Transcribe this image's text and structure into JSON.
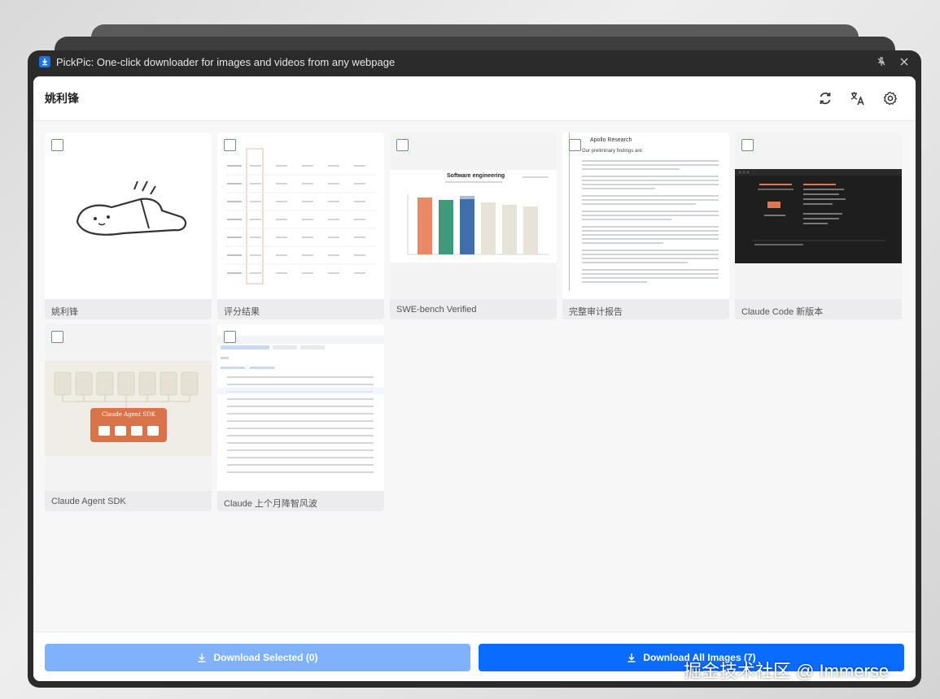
{
  "window": {
    "title": "PickPic: One-click downloader for images and videos from any webpage"
  },
  "header": {
    "title": "姚利锋"
  },
  "icons": {
    "app": "download-icon",
    "pin": "pin-icon",
    "close": "close-icon",
    "refresh": "refresh-icon",
    "translate": "translate-icon",
    "settings": "gear-icon"
  },
  "cards": [
    {
      "label": "姚利锋"
    },
    {
      "label": "评分结果"
    },
    {
      "label": "SWE-bench Verified",
      "chart_title": "Software engineering"
    },
    {
      "label": "完整审计报告",
      "doc_heading": "Apollo Research",
      "doc_subheading": "Our preliminary findings are:"
    },
    {
      "label": "Claude Code 新版本"
    },
    {
      "label": "Claude Agent SDK",
      "box_label": "Claude Agent SDK"
    },
    {
      "label": "Claude 上个月降智风波"
    }
  ],
  "footer": {
    "download_selected": "Download Selected (0)",
    "download_all": "Download All Images (7)"
  },
  "colors": {
    "primary": "#0a6cff",
    "primary_disabled": "#7fb2fb",
    "checkbox": "#4a8df0"
  },
  "watermark": "掘金技术社区 @ Immerse"
}
